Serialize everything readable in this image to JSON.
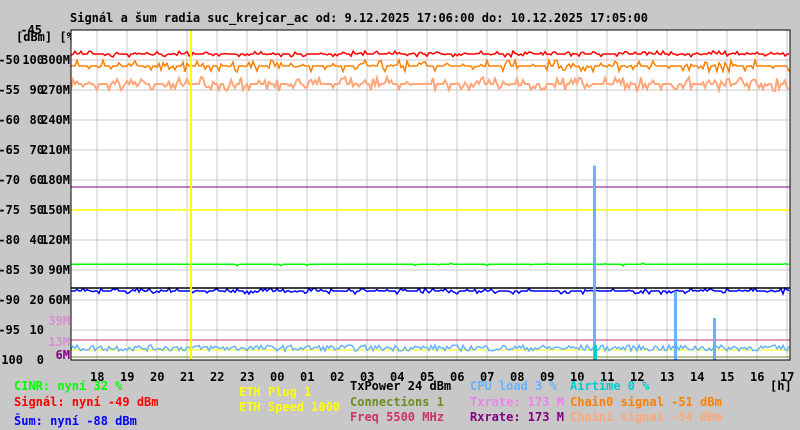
{
  "chart_data": {
    "type": "line",
    "title": "Signál a šum radia suc_krejcar_ac od: 9.12.2025 17:06:00 do: 10.12.2025 17:05:00",
    "yunits_label": "[dBm] [%]",
    "y_dbm_ticks": [
      "-45",
      "-50",
      "-55",
      "-60",
      "-65",
      "-70",
      "-75",
      "-80",
      "-85",
      "-90",
      "-95",
      "-100"
    ],
    "y_pct_ticks": [
      "100",
      "90",
      "80",
      "70",
      "60",
      "50",
      "40",
      "30",
      "20",
      "10",
      "0"
    ],
    "y_rate_ticks": [
      "300M",
      "270M",
      "240M",
      "210M",
      "180M",
      "150M",
      "120M",
      "90M",
      "60M"
    ],
    "y_extra_ticks": [
      {
        "label": "39M",
        "color": "#d58fd5"
      },
      {
        "label": "13M",
        "color": "#d58fd5"
      },
      {
        "label": "6M",
        "color": "#800080"
      }
    ],
    "x_ticks": [
      "18",
      "19",
      "20",
      "21",
      "22",
      "23",
      "00",
      "01",
      "02",
      "03",
      "04",
      "05",
      "06",
      "07",
      "08",
      "09",
      "10",
      "11",
      "12",
      "13",
      "14",
      "15",
      "16",
      "17"
    ],
    "x_unit": "[h]",
    "ylim_dbm": [
      -100,
      -45
    ],
    "marker_hour": 21.1,
    "series": [
      {
        "name": "Signál",
        "unit": "dBm",
        "value": -49,
        "color": "#ff0000"
      },
      {
        "name": "Chain0 signal",
        "unit": "dBm",
        "value": -51,
        "color": "#ff8000"
      },
      {
        "name": "Chain1 signal",
        "unit": "dBm",
        "value": -54,
        "color": "#ffa77a"
      },
      {
        "name": "Šum",
        "unit": "dBm",
        "value": -88,
        "color": "#0000ff"
      },
      {
        "name": "CINR",
        "unit": "%",
        "value": 32,
        "color": "#00ff00"
      },
      {
        "name": "Rxrate",
        "unit": "M",
        "value": 173,
        "color": "#800080"
      },
      {
        "name": "ETH Speed",
        "unit": "M",
        "value": 1000,
        "color": "#ffff00"
      },
      {
        "name": "CPU load",
        "unit": "%",
        "value": 3,
        "color": "#66b2ff",
        "spikes": [
          {
            "hour": 10.5,
            "value": 65
          },
          {
            "hour": 13.2,
            "value": 23
          },
          {
            "hour": 14.5,
            "value": 14
          }
        ]
      },
      {
        "name": "Airtime",
        "unit": "%",
        "value": 0,
        "color": "#00cccc"
      },
      {
        "name": "Freq",
        "unit": "MHz",
        "value": 5500,
        "color": "#cc3366"
      }
    ]
  },
  "legend": {
    "cinr": "CINR: nyní 32 %",
    "signal": "Signál: nyní -49 dBm",
    "noise": "Šum: nyní -88 dBm",
    "eth_plug": "ETH Plug 1",
    "eth_speed": "ETH Speed 1000",
    "txpower": "TxPower 24 dBm",
    "connections": "Connections 1",
    "freq": "Freq 5500 MHz",
    "cpu": "CPU load 3 %",
    "txrate": "Txrate: 173 M",
    "rxrate": "Rxrate: 173 M",
    "airtime": "Airtime 0 %",
    "chain0": "Chain0 signal -51 dBm",
    "chain1": "Chain1 signal -54 dBm"
  }
}
